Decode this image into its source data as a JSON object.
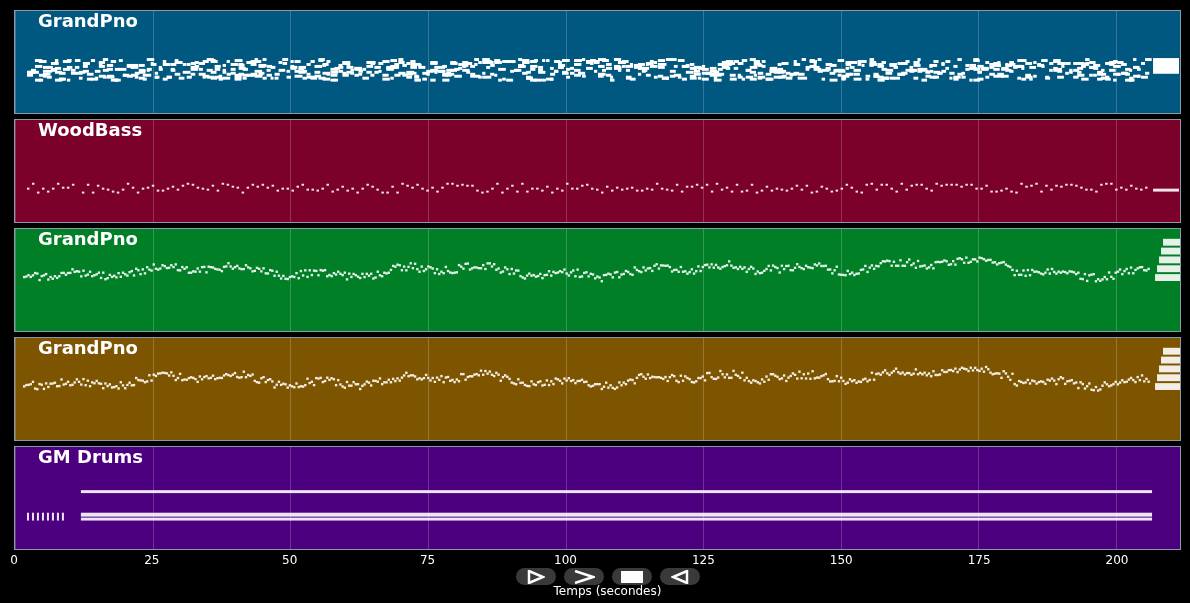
{
  "tracks": [
    {
      "name": "GrandPno",
      "color": "#00577f",
      "kind": "chords"
    },
    {
      "name": "WoodBass",
      "color": "#7b002a",
      "kind": "bass"
    },
    {
      "name": "GrandPno",
      "color": "#007f27",
      "kind": "melody"
    },
    {
      "name": "GrandPno",
      "color": "#7d5500",
      "kind": "melody"
    },
    {
      "name": "GM Drums",
      "color": "#4c007f",
      "kind": "drums"
    }
  ],
  "axis": {
    "ticks": [
      "0",
      "25",
      "50",
      "75",
      "100",
      "125",
      "150",
      "175",
      "200"
    ],
    "label": "Temps (secondes)"
  },
  "controls": [
    {
      "kind": "play"
    },
    {
      "kind": "next"
    },
    {
      "kind": "stop"
    },
    {
      "kind": "rewind"
    }
  ]
}
